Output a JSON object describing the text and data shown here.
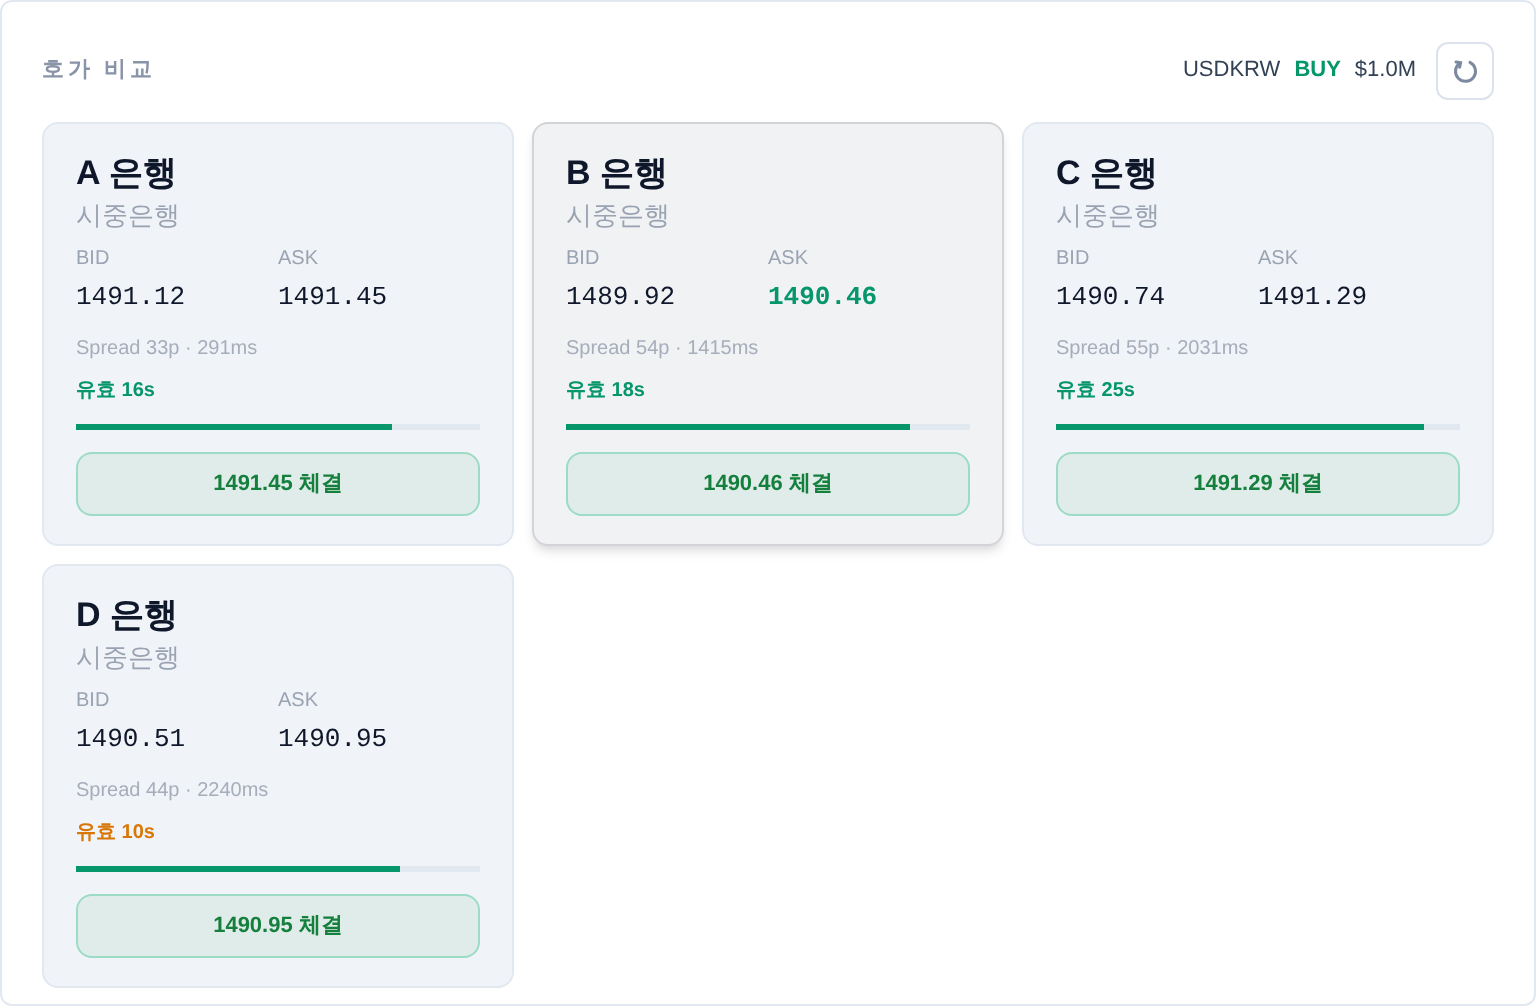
{
  "header": {
    "title": "호가 비교",
    "pair": "USDKRW",
    "side": "BUY",
    "amount": "$1.0M"
  },
  "banks": [
    {
      "name": "A 은행",
      "type": "시중은행",
      "bid_label": "BID",
      "bid": "1491.12",
      "ask_label": "ASK",
      "ask": "1491.45",
      "ask_best": false,
      "spread": "Spread 33p · 291ms",
      "validity": "유효 16s",
      "color": "#059669",
      "level": 0.78,
      "action": "1491.45 체결",
      "selected": false
    },
    {
      "name": "B 은행",
      "type": "시중은행",
      "bid_label": "BID",
      "bid": "1489.92",
      "ask_label": "ASK",
      "ask": "1490.46",
      "ask_best": true,
      "spread": "Spread 54p · 1415ms",
      "validity": "유효 18s",
      "color": "#059669",
      "level": 0.85,
      "action": "1490.46 체결",
      "selected": true
    },
    {
      "name": "C 은행",
      "type": "시중은행",
      "bid_label": "BID",
      "bid": "1490.74",
      "ask_label": "ASK",
      "ask": "1491.29",
      "ask_best": false,
      "spread": "Spread 55p · 2031ms",
      "validity": "유효 25s",
      "color": "#059669",
      "level": 0.91,
      "action": "1491.29 체결",
      "selected": false
    },
    {
      "name": "D 은행",
      "type": "시중은행",
      "bid_label": "BID",
      "bid": "1490.51",
      "ask_label": "ASK",
      "ask": "1490.95",
      "ask_best": false,
      "spread": "Spread 44p · 2240ms",
      "validity": "유효 10s",
      "color": "#d97706",
      "level": 0.8,
      "action": "1490.95 체결",
      "selected": false
    }
  ]
}
